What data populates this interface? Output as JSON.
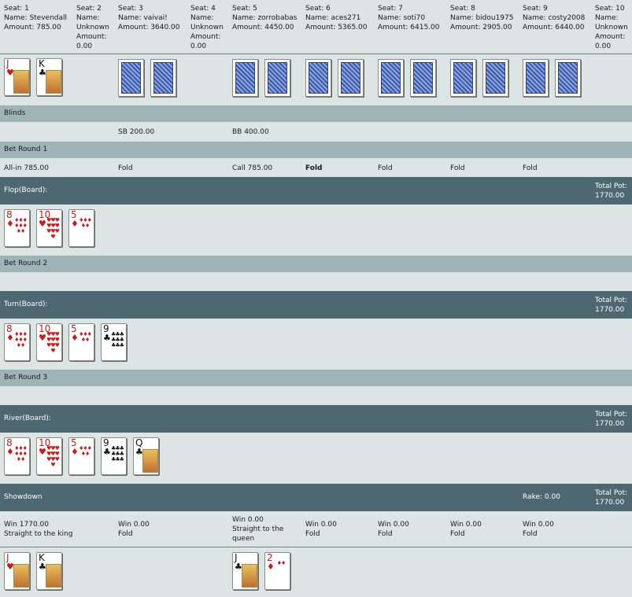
{
  "seats": [
    {
      "text": "Seat: 1\nName: Stevendall\nAmount: 785.00"
    },
    {
      "text": "Seat: 2\nName:\nUnknown\nAmount:\n0.00"
    },
    {
      "text": "Seat: 3\nName: vaivai!\nAmount: 3640.00"
    },
    {
      "text": "Seat: 4\nName:\nUnknown\nAmount:\n0.00"
    },
    {
      "text": "Seat: 5\nName: zorrobabas\nAmount: 4450.00"
    },
    {
      "text": "Seat: 6\nName: aces271\nAmount: 5365.00"
    },
    {
      "text": "Seat: 7\nName: soti70\nAmount: 6415.00"
    },
    {
      "text": "Seat: 8\nName: bidou1975\nAmount: 2905.00"
    },
    {
      "text": "Seat: 9\nName: costy2008\nAmount: 6440.00"
    },
    {
      "text": "Seat: 10\nName:\nUnknown\nAmount:\n0.00"
    }
  ],
  "sections": {
    "blinds": "Blinds",
    "bet_round_1": "Bet Round 1",
    "flop": "Flop(Board):",
    "bet_round_2": "Bet Round 2",
    "turn": "Turn(Board):",
    "bet_round_3": "Bet Round 3",
    "river": "River(Board):",
    "showdown": "Showdown"
  },
  "blinds": {
    "sb": "SB 200.00",
    "bb": "BB 400.00"
  },
  "bet_round_1": {
    "seat1": "All-in 785.00",
    "seat3": "Fold",
    "seat5": "Call 785.00",
    "seat6": "Fold",
    "seat7": "Fold",
    "seat8": "Fold",
    "seat9": "Fold"
  },
  "pot": {
    "flop": "Total Pot:\n1770.00",
    "turn": "Total Pot:\n1770.00",
    "river": "Total Pot:\n1770.00",
    "showdown": "Total Pot:\n1770.00"
  },
  "rake": "Rake: 0.00",
  "results": {
    "seat1": "Win 1770.00\nStraight to the king",
    "seat3": "Win 0.00\nFold",
    "seat5": "Win 0.00\nStraight to the\nqueen",
    "seat6": "Win 0.00\nFold",
    "seat7": "Win 0.00\nFold",
    "seat8": "Win 0.00\nFold",
    "seat9": "Win 0.00\nFold"
  },
  "cards": {
    "hole_seat1": [
      {
        "rank": "J",
        "suit": "♥",
        "color": "#d01818"
      },
      {
        "rank": "K",
        "suit": "♣",
        "color": "#111111"
      }
    ],
    "flop": [
      {
        "rank": "8",
        "suit": "♦",
        "color": "#d01818"
      },
      {
        "rank": "10",
        "suit": "♥",
        "color": "#d01818"
      },
      {
        "rank": "5",
        "suit": "♦",
        "color": "#d01818"
      }
    ],
    "turn": [
      {
        "rank": "8",
        "suit": "♦",
        "color": "#d01818"
      },
      {
        "rank": "10",
        "suit": "♥",
        "color": "#d01818"
      },
      {
        "rank": "5",
        "suit": "♦",
        "color": "#d01818"
      },
      {
        "rank": "9",
        "suit": "♣",
        "color": "#111111"
      }
    ],
    "river": [
      {
        "rank": "8",
        "suit": "♦",
        "color": "#d01818"
      },
      {
        "rank": "10",
        "suit": "♥",
        "color": "#d01818"
      },
      {
        "rank": "5",
        "suit": "♦",
        "color": "#d01818"
      },
      {
        "rank": "9",
        "suit": "♣",
        "color": "#111111"
      },
      {
        "rank": "Q",
        "suit": "♣",
        "color": "#111111"
      }
    ],
    "showdown_seat1": [
      {
        "rank": "J",
        "suit": "♥",
        "color": "#d01818"
      },
      {
        "rank": "K",
        "suit": "♣",
        "color": "#111111"
      }
    ],
    "showdown_seat5": [
      {
        "rank": "J",
        "suit": "♣",
        "color": "#111111"
      },
      {
        "rank": "2",
        "suit": "♦",
        "color": "#d01818"
      }
    ]
  },
  "colors": {
    "background": "#dce4e4",
    "band_light": "#9fb4b6",
    "band_dark": "#4d6870"
  }
}
